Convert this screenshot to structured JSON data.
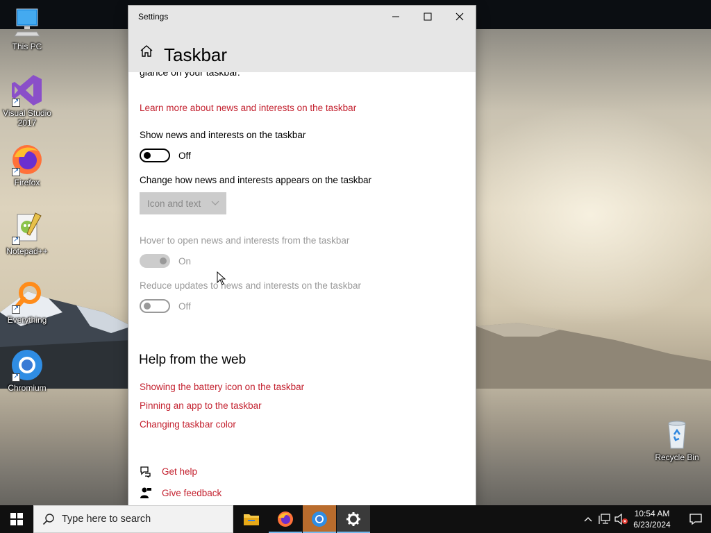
{
  "desktop": {
    "icons": [
      {
        "label": "This PC"
      },
      {
        "label": "Visual Studio 2017"
      },
      {
        "label": "Firefox"
      },
      {
        "label": "Notepad++"
      },
      {
        "label": "Everything"
      },
      {
        "label": "Chromium"
      },
      {
        "label": "Recycle Bin"
      }
    ]
  },
  "window": {
    "title": "Settings",
    "page_title": "Taskbar",
    "cut_text": "glance on your taskbar.",
    "learn_more_link": "Learn more about news and interests on the taskbar",
    "show_news": {
      "label": "Show news and interests on the taskbar",
      "state": "Off"
    },
    "appearance": {
      "label": "Change how news and interests appears on the taskbar",
      "selected": "Icon and text"
    },
    "hover_open": {
      "label": "Hover to open news and interests from the taskbar",
      "state": "On"
    },
    "reduce_updates": {
      "label": "Reduce updates to news and interests on the taskbar",
      "state": "Off"
    },
    "help_section_title": "Help from the web",
    "help_links": [
      "Showing the battery icon on the taskbar",
      "Pinning an app to the taskbar",
      "Changing taskbar color"
    ],
    "get_help": "Get help",
    "give_feedback": "Give feedback",
    "accent_color": "#c3202e"
  },
  "taskbar": {
    "search_placeholder": "Type here to search",
    "apps": [
      "file-explorer",
      "firefox",
      "chromium",
      "settings"
    ],
    "time": "10:54 AM",
    "date": "6/23/2024"
  }
}
